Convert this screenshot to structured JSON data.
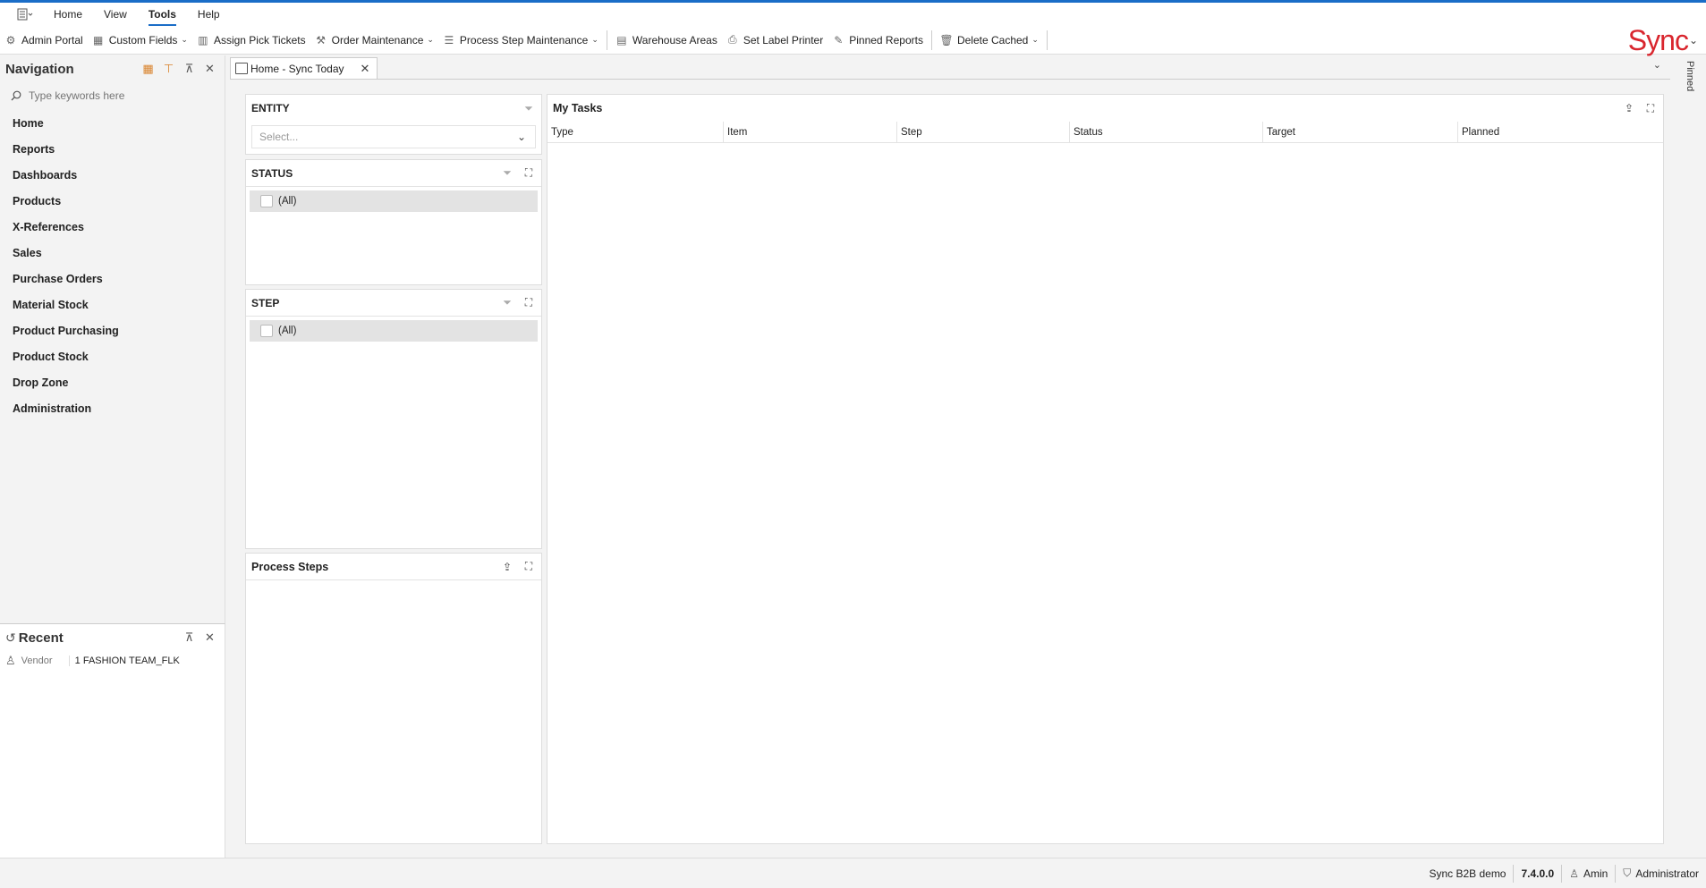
{
  "menubar": {
    "items": [
      "Home",
      "View",
      "Tools",
      "Help"
    ],
    "active": "Tools"
  },
  "ribbon": {
    "admin_portal": "Admin Portal",
    "custom_fields": "Custom Fields",
    "assign_pick_tickets": "Assign Pick Tickets",
    "order_maintenance": "Order Maintenance",
    "process_step_maintenance": "Process Step Maintenance",
    "warehouse_areas": "Warehouse Areas",
    "set_label_printer": "Set Label Printer",
    "pinned_reports": "Pinned Reports",
    "delete_cached": "Delete Cached",
    "logo": "Sync"
  },
  "navigation": {
    "title": "Navigation",
    "search_placeholder": "Type keywords here",
    "items": [
      "Home",
      "Reports",
      "Dashboards",
      "Products",
      "X-References",
      "Sales",
      "Purchase Orders",
      "Material Stock",
      "Product Purchasing",
      "Product Stock",
      "Drop Zone",
      "Administration"
    ]
  },
  "recent": {
    "title": "Recent",
    "items": [
      {
        "type": "Vendor",
        "name": "1 FASHION TEAM_FLK"
      }
    ]
  },
  "tabs": {
    "home_tab": "Home - Sync Today",
    "pinned": "Pinned"
  },
  "entity": {
    "title": "ENTITY",
    "select_placeholder": "Select..."
  },
  "status_panel": {
    "title": "STATUS",
    "all_label": "(All)"
  },
  "step_panel": {
    "title": "STEP",
    "all_label": "(All)"
  },
  "process_steps": {
    "title": "Process Steps"
  },
  "my_tasks": {
    "title": "My Tasks",
    "columns": [
      "Type",
      "Item",
      "Step",
      "Status",
      "Target",
      "Planned"
    ]
  },
  "statusbar": {
    "env": "Sync B2B demo",
    "version": "7.4.0.0",
    "user": "Amin",
    "role": "Administrator"
  },
  "colors": {
    "accent": "#1a6dc7",
    "brand": "#d9262e"
  }
}
